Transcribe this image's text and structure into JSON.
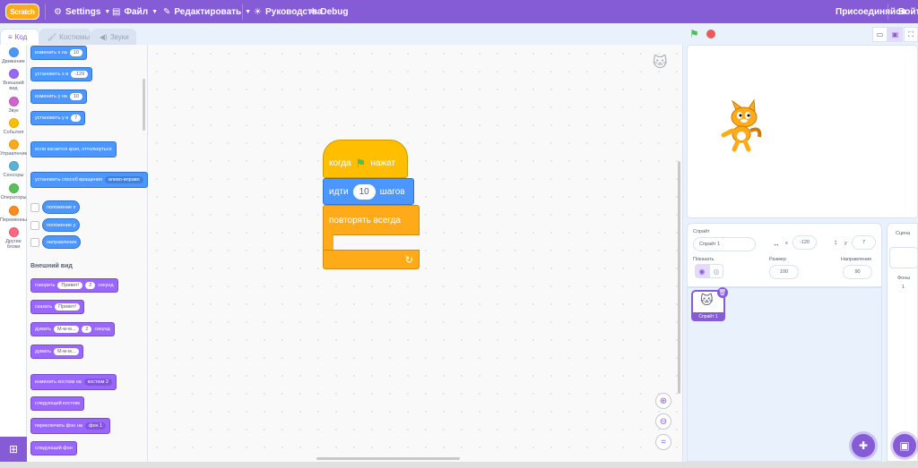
{
  "menubar": {
    "logo_text": "Scratch",
    "settings": "Settings",
    "file": "Файл",
    "edit": "Редактировать",
    "tutorials": "Руководства",
    "debug": "Debug",
    "join": "Присоединяйся",
    "signin": "Войти"
  },
  "tabs": {
    "code": "Код",
    "costumes": "Костюмы",
    "sounds": "Звуки"
  },
  "categories": [
    {
      "label": "Движение",
      "color": "#4c97ff"
    },
    {
      "label": "Внешний вид",
      "color": "#9966ff"
    },
    {
      "label": "Звук",
      "color": "#cf63cf"
    },
    {
      "label": "События",
      "color": "#ffbf00"
    },
    {
      "label": "Управление",
      "color": "#ffab19"
    },
    {
      "label": "Сенсоры",
      "color": "#5cb1d6"
    },
    {
      "label": "Операторы",
      "color": "#59c059"
    },
    {
      "label": "Переменные",
      "color": "#ff8c1a"
    },
    {
      "label": "Другие блоки",
      "color": "#ff6680"
    }
  ],
  "palette": {
    "change_x": {
      "text": "изменить x на",
      "value": "10"
    },
    "set_x": {
      "text": "установить x в",
      "value": "-129"
    },
    "change_y": {
      "text": "изменить y на",
      "value": "10"
    },
    "set_y": {
      "text": "установить y в",
      "value": "7"
    },
    "bounce": "если касается края, оттолкнуться",
    "rotation_style": {
      "text": "установить способ вращения",
      "value": "влево-вправо"
    },
    "x_position": "положение x",
    "y_position": "положение y",
    "direction": "направление",
    "looks_heading": "Внешний вид",
    "say_for": {
      "text": "говорить",
      "msg": "Привет!",
      "secs": "2",
      "unit": "секунд"
    },
    "say": {
      "text": "сказать",
      "msg": "Привет!"
    },
    "think_for": {
      "text": "думать",
      "msg": "М-м-м...",
      "secs": "2",
      "unit": "секунд"
    },
    "think": {
      "text": "думать",
      "msg": "М-м-м..."
    },
    "switch_costume": {
      "text": "изменить костюм на",
      "value": "костюм 2"
    },
    "next_costume": "следующий костюм",
    "switch_backdrop": {
      "text": "переключить фон на",
      "value": "фон 1"
    },
    "next_backdrop": "следующий фон"
  },
  "script": {
    "hat": {
      "when": "когда",
      "clicked": "нажат"
    },
    "move": {
      "text": "идти",
      "value": "10",
      "unit": "шагов"
    },
    "forever": "повторять всегда"
  },
  "sprite_panel": {
    "sprite_label": "Спрайт",
    "sprite_name": "Спрайт 1",
    "x_label": "x",
    "x_value": "-120",
    "y_label": "y",
    "y_value": "7",
    "show_label": "Показать",
    "size_label": "Размер",
    "size_value": "100",
    "direction_label": "Направление",
    "direction_value": "90",
    "thumb_name": "Спрайт 1"
  },
  "scene_panel": {
    "title": "Сцена",
    "backdrops_label": "Фоны",
    "backdrops_count": "1"
  }
}
